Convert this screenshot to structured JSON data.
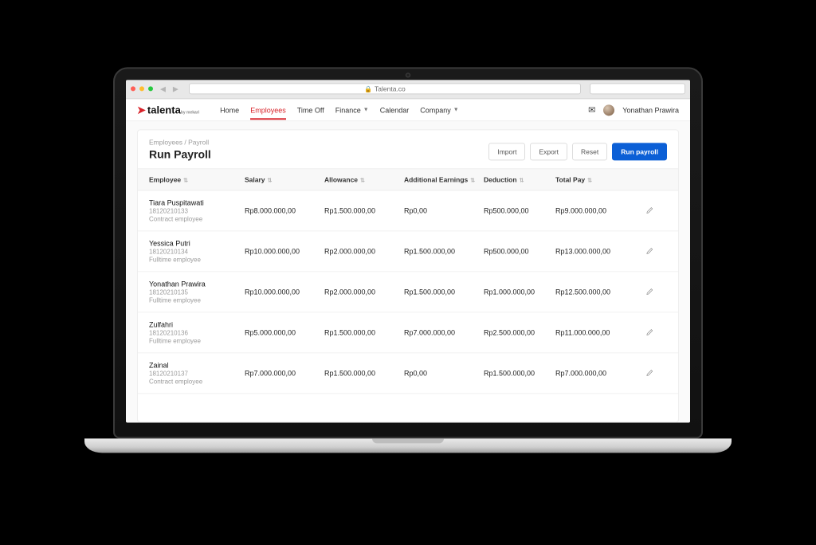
{
  "browser": {
    "url": "Talenta.co"
  },
  "brand": {
    "name": "talenta",
    "byline": "by mekari"
  },
  "nav": {
    "items": [
      {
        "label": "Home"
      },
      {
        "label": "Employees"
      },
      {
        "label": "Time Off"
      },
      {
        "label": "Finance"
      },
      {
        "label": "Calendar"
      },
      {
        "label": "Company"
      }
    ],
    "active_index": 1
  },
  "user": {
    "name": "Yonathan Prawira"
  },
  "breadcrumb": "Employees / Payroll",
  "page_title": "Run Payroll",
  "actions": {
    "import": "Import",
    "export": "Export",
    "reset": "Reset",
    "run": "Run payroll"
  },
  "columns": {
    "employee": "Employee",
    "salary": "Salary",
    "allowance": "Allowance",
    "additional": "Additional Earnings",
    "deduction": "Deduction",
    "total": "Total Pay"
  },
  "rows": [
    {
      "name": "Tiara Puspitawati",
      "id": "18120210133",
      "type": "Contract employee",
      "salary": "Rp8.000.000,00",
      "allowance": "Rp1.500.000,00",
      "additional": "Rp0,00",
      "deduction": "Rp500.000,00",
      "total": "Rp9.000.000,00"
    },
    {
      "name": "Yessica Putri",
      "id": "18120210134",
      "type": "Fulltime employee",
      "salary": "Rp10.000.000,00",
      "allowance": "Rp2.000.000,00",
      "additional": "Rp1.500.000,00",
      "deduction": "Rp500.000,00",
      "total": "Rp13.000.000,00"
    },
    {
      "name": "Yonathan Prawira",
      "id": "18120210135",
      "type": "Fulltime employee",
      "salary": "Rp10.000.000,00",
      "allowance": "Rp2.000.000,00",
      "additional": "Rp1.500.000,00",
      "deduction": "Rp1.000.000,00",
      "total": "Rp12.500.000,00"
    },
    {
      "name": "Zulfahri",
      "id": "18120210136",
      "type": "Fulltime employee",
      "salary": "Rp5.000.000,00",
      "allowance": "Rp1.500.000,00",
      "additional": "Rp7.000.000,00",
      "deduction": "Rp2.500.000,00",
      "total": "Rp11.000.000,00"
    },
    {
      "name": "Zainal",
      "id": "18120210137",
      "type": "Contract employee",
      "salary": "Rp7.000.000,00",
      "allowance": "Rp1.500.000,00",
      "additional": "Rp0,00",
      "deduction": "Rp1.500.000,00",
      "total": "Rp7.000.000,00"
    }
  ]
}
